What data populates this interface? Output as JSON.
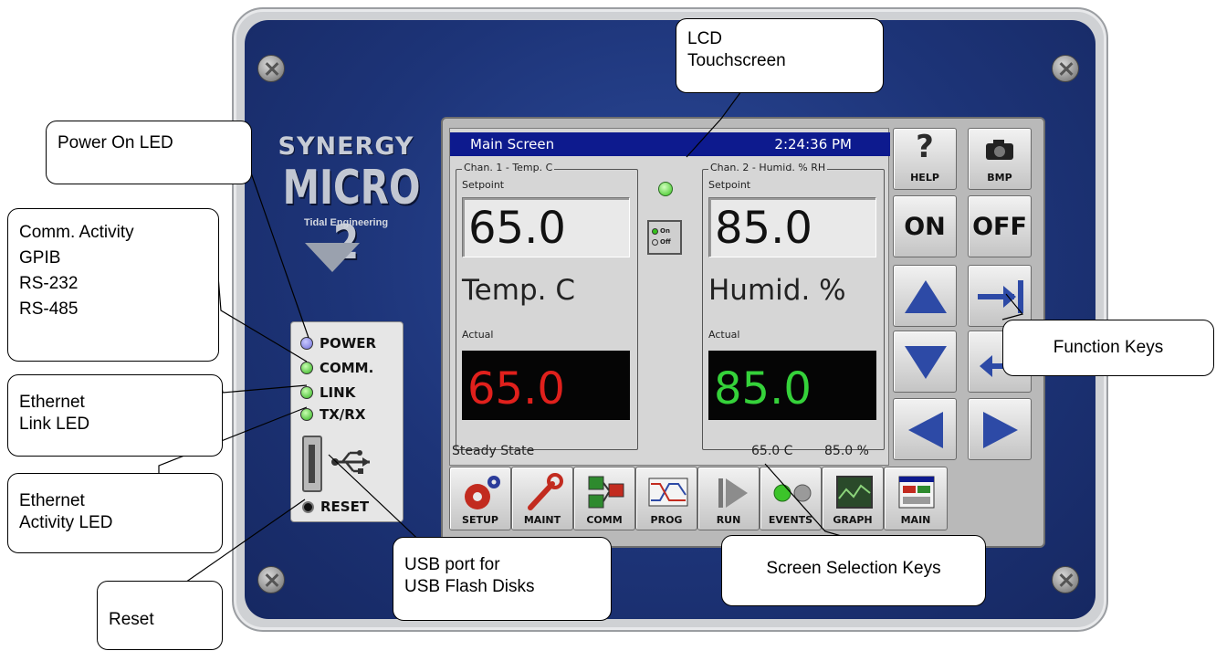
{
  "device": {
    "brand_name": "SYNERGY",
    "model": "MICRO 2",
    "maker": "Tidal Engineering",
    "leds": [
      {
        "label": "POWER",
        "color": "blue"
      },
      {
        "label": "COMM.",
        "color": "green"
      },
      {
        "label": "LINK",
        "color": "green"
      },
      {
        "label": "TX/RX",
        "color": "green"
      }
    ],
    "reset_label": "RESET",
    "usb_symbol": "⭠"
  },
  "screen": {
    "title": "Main Screen",
    "clock": "2:24:36 PM",
    "channels": [
      {
        "legend": "Chan. 1 - Temp. C",
        "setpoint_label": "Setpoint",
        "setpoint": "65.0",
        "unit": "Temp. C",
        "actual_label": "Actual",
        "actual": "65.0",
        "actual_color": "#e0201c"
      },
      {
        "legend": "Chan. 2 - Humid. % RH",
        "setpoint_label": "Setpoint",
        "setpoint": "85.0",
        "unit": "Humid. %",
        "actual_label": "Actual",
        "actual": "85.0",
        "actual_color": "#35d23a"
      }
    ],
    "onoff_on": "On",
    "onoff_off": "Off",
    "status_left": "Steady State",
    "status_temp": "65.0 C",
    "status_humid": "85.0 %"
  },
  "keypad": {
    "help": "HELP",
    "help_glyph": "?",
    "bmp": "BMP",
    "on": "ON",
    "off": "OFF"
  },
  "screen_keys": [
    "SETUP",
    "MAINT",
    "COMM",
    "PROG",
    "RUN",
    "EVENTS",
    "GRAPH",
    "MAIN"
  ],
  "callouts": {
    "lcd": "LCD\nTouchscreen",
    "power": "Power On LED",
    "comm": "Comm. Activity\n  GPIB\n  RS-232\n  RS-485",
    "link": "Ethernet\nLink LED",
    "activity": "Ethernet\nActivity LED",
    "reset": "Reset",
    "usb": "USB port for\nUSB Flash Disks",
    "screen_sel": "Screen Selection Keys",
    "function": "Function Keys"
  },
  "colors": {
    "panel_blue": "#1d3478",
    "title_blue": "#0d1a8e",
    "arrow_blue": "#2d4aa6"
  }
}
